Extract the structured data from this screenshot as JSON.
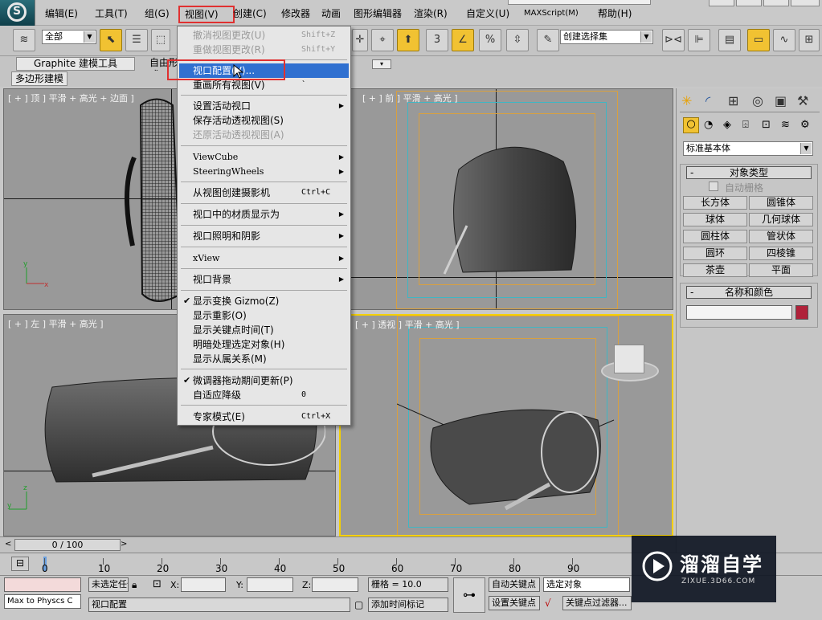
{
  "menubar": {
    "items": [
      "编辑(E)",
      "工具(T)",
      "组(G)",
      "视图(V)",
      "创建(C)",
      "修改器",
      "动画",
      "图形编辑器",
      "渲染(R)",
      "自定义(U)",
      "MAXScript(M)",
      "帮助(H)"
    ]
  },
  "toolbar": {
    "selection_filter": "全部",
    "angle_snap_label": "3",
    "named_selection": "创建选择集"
  },
  "ribbon": {
    "tab_graphite": "Graphite 建模工具",
    "tab_freeform": "自由形式",
    "sub_tab": "多边形建模"
  },
  "viewports": {
    "top_label": "[ + ] 顶 ] 平滑 + 高光 + 边面 ]",
    "front_label": "[ + ] 前 ] 平滑 + 高光 ]",
    "left_label": "[ + ] 左 ] 平滑 + 高光 ]",
    "persp_label": "[ + ] 透视 ] 平滑 + 高光 ]"
  },
  "view_menu": {
    "items": [
      {
        "label": "撤消视图更改(U)",
        "shortcut": "Shift+Z",
        "disabled": true
      },
      {
        "label": "重做视图更改(R)",
        "shortcut": "Shift+Y",
        "disabled": true
      },
      {
        "label": "视口配置(V)...",
        "highlighted": true
      },
      {
        "label": "重画所有视图(V)",
        "shortcut": "`"
      },
      {
        "label": "设置活动视口",
        "submenu": true
      },
      {
        "label": "保存活动透视视图(S)"
      },
      {
        "label": "还原活动透视视图(A)",
        "disabled": true
      },
      {
        "label": "ViewCube",
        "submenu": true
      },
      {
        "label": "SteeringWheels",
        "submenu": true
      },
      {
        "label": "从视图创建摄影机",
        "shortcut": "Ctrl+C"
      },
      {
        "label": "视口中的材质显示为",
        "submenu": true
      },
      {
        "label": "视口照明和阴影",
        "submenu": true
      },
      {
        "label": "xView",
        "submenu": true
      },
      {
        "label": "视口背景",
        "submenu": true
      },
      {
        "label": "显示变换 Gizmo(Z)",
        "checked": true
      },
      {
        "label": "显示重影(O)"
      },
      {
        "label": "显示关键点时间(T)"
      },
      {
        "label": "明暗处理选定对象(H)"
      },
      {
        "label": "显示从属关系(M)"
      },
      {
        "label": "微调器拖动期间更新(P)",
        "checked": true
      },
      {
        "label": "自适应降级",
        "shortcut": "0"
      },
      {
        "label": "专家模式(E)",
        "shortcut": "Ctrl+X"
      }
    ]
  },
  "command_panel": {
    "category": "标准基本体",
    "object_type_title": "对象类型",
    "autogrid_label": "自动栅格",
    "buttons": [
      "长方体",
      "圆锥体",
      "球体",
      "几何球体",
      "圆柱体",
      "管状体",
      "圆环",
      "四棱锥",
      "茶壶",
      "平面"
    ],
    "name_color_title": "名称和颜色",
    "name_value": "",
    "object_color": "#b0223a"
  },
  "timeline": {
    "frame_display": "0 / 100",
    "ticks": [
      "0",
      "10",
      "20",
      "30",
      "40",
      "50",
      "60",
      "70",
      "80",
      "90"
    ]
  },
  "status": {
    "selection": "未选定任何对象",
    "x_label": "X:",
    "y_label": "Y:",
    "z_label": "Z:",
    "grid": "栅格 = 10.0",
    "auto_key": "自动关键点",
    "selected_label": "选定对象",
    "set_key": "设置关键点",
    "key_filters": "关键点过滤器...",
    "add_time_tag": "添加时间标记",
    "prompt": "视口配置",
    "script_listener": "Max to Physcs C"
  },
  "watermark": {
    "title": "溜溜自学",
    "url": "ZIXUE.3D66.COM"
  },
  "colors": {
    "menu_highlight": "#3070d0",
    "selection_yellow": "#f1c232",
    "annotation_red": "#e03030",
    "viewport_gray": "#999999"
  }
}
